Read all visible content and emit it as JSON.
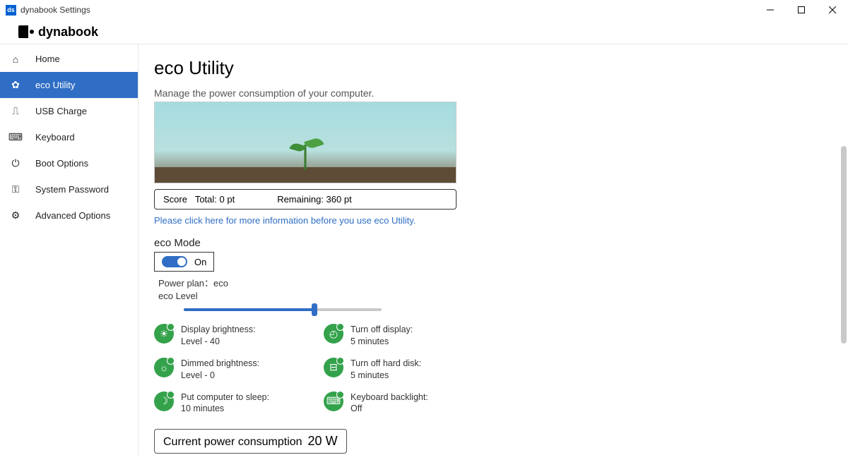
{
  "window": {
    "title": "dynabook Settings",
    "brand": "dynabook"
  },
  "sidebar": {
    "items": [
      {
        "label": "Home",
        "icon": "home-icon"
      },
      {
        "label": "eco Utility",
        "icon": "eco-icon"
      },
      {
        "label": "USB Charge",
        "icon": "usb-icon"
      },
      {
        "label": "Keyboard",
        "icon": "keyboard-icon"
      },
      {
        "label": "Boot Options",
        "icon": "power-icon"
      },
      {
        "label": "System Password",
        "icon": "key-icon"
      },
      {
        "label": "Advanced Options",
        "icon": "gear-icon"
      }
    ],
    "active_index": 1
  },
  "page": {
    "title": "eco Utility",
    "description": "Manage the power consumption of your computer.",
    "score_label": "Score",
    "total_label": "Total: 0 pt",
    "remaining_label": "Remaining: 360 pt",
    "info_link": "Please click here for more information before you use eco Utility.",
    "eco_mode_heading": "eco Mode",
    "toggle_state": "On",
    "plan_line": "Power plan：eco",
    "level_line": "eco Level",
    "slider_percent": 66,
    "settings": [
      {
        "title": "Display brightness:",
        "value": "Level - 40",
        "icon": "brightness-icon"
      },
      {
        "title": "Turn off display:",
        "value": "5 minutes",
        "icon": "display-off-icon"
      },
      {
        "title": "Dimmed brightness:",
        "value": "Level - 0",
        "icon": "dim-icon"
      },
      {
        "title": "Turn off hard disk:",
        "value": "5 minutes",
        "icon": "hdd-icon"
      },
      {
        "title": "Put computer to sleep:",
        "value": "10 minutes",
        "icon": "sleep-icon"
      },
      {
        "title": "Keyboard backlight:",
        "value": "Off",
        "icon": "backlight-icon"
      }
    ],
    "power_label": "Current power consumption",
    "power_value": "20 W"
  }
}
